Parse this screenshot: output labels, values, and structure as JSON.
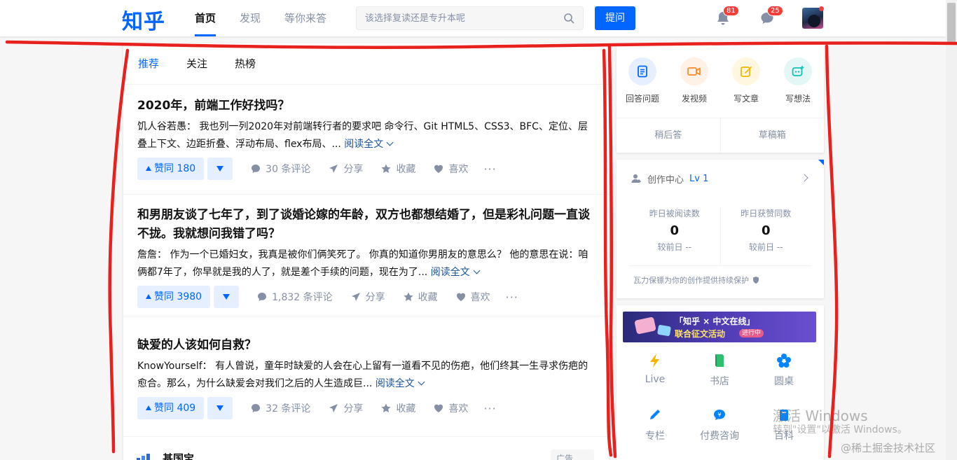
{
  "header": {
    "logo": "知乎",
    "nav": [
      "首页",
      "发现",
      "等你来答"
    ],
    "search_placeholder": "该选择复读还是专升本呢",
    "ask_label": "提问",
    "notif_count": "81",
    "msg_count": "25"
  },
  "feed": {
    "tabs": [
      "推荐",
      "关注",
      "热榜"
    ],
    "cards": [
      {
        "title": "2020年，前端工作好找吗？",
        "excerpt": "饥人谷若愚： 我也列一列2020年对前端转行者的要求吧 命令行、Git HTML5、CSS3、BFC、定位、层叠上下文、边距折叠、浮动布局、flex布局、...",
        "read_more": "阅读全文",
        "vote": "赞同 180",
        "comments": "30 条评论",
        "share": "分享",
        "collect": "收藏",
        "like": "喜欢"
      },
      {
        "title": "和男朋友谈了七年了，到了谈婚论嫁的年龄，双方也都想结婚了，但是彩礼问题一直谈不拢。我就想问我错了吗？",
        "excerpt": "詹詹： 作为一个已婚妇女，我真是被你们俩笑死了。 你真的知道你男朋友的意思么？ 他的意思在说：咱俩都7年了，你早就是我的人了，就是差个手续的问题，现在为了...",
        "read_more": "阅读全文",
        "vote": "赞同 3980",
        "comments": "1,832 条评论",
        "share": "分享",
        "collect": "收藏",
        "like": "喜欢"
      },
      {
        "title": "缺爱的人该如何自救？",
        "excerpt": "KnowYourself： 有人曾说，童年时缺爱的人会在心上留有一道看不见的伤疤，他们终其一生寻求伤疤的愈合。那么，为什么缺爱会对我们之后的人生造成巨...",
        "read_more": "阅读全文",
        "vote": "赞同 409",
        "comments": "32 条评论",
        "share": "分享",
        "collect": "收藏",
        "like": "喜欢"
      }
    ],
    "partial_card_title": "基国宝",
    "partial_card_tag": "广告"
  },
  "sidebar": {
    "quick": [
      "回答问题",
      "发视频",
      "写文章",
      "写想法"
    ],
    "quick_bottom": [
      "稍后答",
      "草稿箱"
    ],
    "creator_title": "创作中心",
    "creator_level": "Lv 1",
    "stats": [
      {
        "label": "昨日被阅读数",
        "value": "0",
        "compare": "较前日 --"
      },
      {
        "label": "昨日获赞同数",
        "value": "0",
        "compare": "较前日 --"
      }
    ],
    "creator_footer": "瓦力保镖为你的创作提供持续保护",
    "banner_line1": "「知乎 × 中文在线」",
    "banner_line2": "联合征文活动",
    "banner_tag": "进行中",
    "grid": [
      "Live",
      "书店",
      "圆桌",
      "专栏",
      "付费咨询",
      "百科"
    ]
  },
  "watermark": {
    "activate_title": "激活 Windows",
    "activate_sub": "转到\"设置\"以激活 Windows。",
    "site": "@稀土掘金技术社区"
  },
  "colors": {
    "brand": "#0066ff",
    "annotation": "#e8201e"
  }
}
